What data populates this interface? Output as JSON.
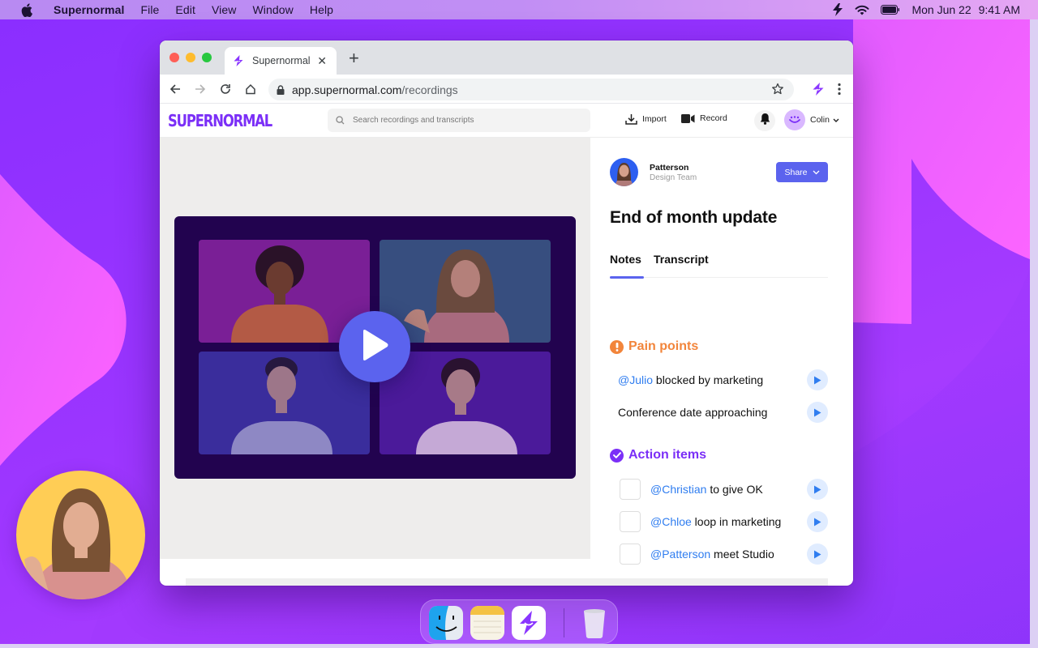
{
  "menubar": {
    "app_name": "Supernormal",
    "items": [
      "File",
      "Edit",
      "View",
      "Window",
      "Help"
    ],
    "date": "Mon Jun 22",
    "time": "9:41 AM"
  },
  "browser": {
    "tab_title": "Supernormal",
    "url_host": "app.supernormal.com",
    "url_path": "/recordings"
  },
  "app": {
    "logo": "Supernormal",
    "search_placeholder": "Search recordings and transcripts",
    "import_label": "Import",
    "record_label": "Record",
    "user_name": "Colin"
  },
  "recording": {
    "presenter_name": "Patterson",
    "presenter_team": "Design Team",
    "share_label": "Share",
    "title": "End of month update",
    "tabs": [
      {
        "label": "Notes",
        "active": true
      },
      {
        "label": "Transcript",
        "active": false
      }
    ],
    "pain_points": {
      "heading": "Pain points",
      "items": [
        {
          "mention": "@Julio",
          "text": " blocked by marketing"
        },
        {
          "mention": "",
          "text": "Conference date approaching"
        }
      ]
    },
    "action_items": {
      "heading": "Action items",
      "items": [
        {
          "mention": "@Christian",
          "text": " to give OK",
          "done": false
        },
        {
          "mention": "@Chloe",
          "text": " loop in marketing",
          "done": false
        },
        {
          "mention": "@Patterson",
          "text": " meet Studio",
          "done": false
        }
      ]
    }
  },
  "colors": {
    "brand": "#7b2ff7",
    "accent": "#5b63ee",
    "pain": "#f2853b",
    "mention": "#2f7df0"
  },
  "dock": {
    "apps": [
      "Finder",
      "Notes",
      "Supernormal",
      "Trash"
    ]
  }
}
